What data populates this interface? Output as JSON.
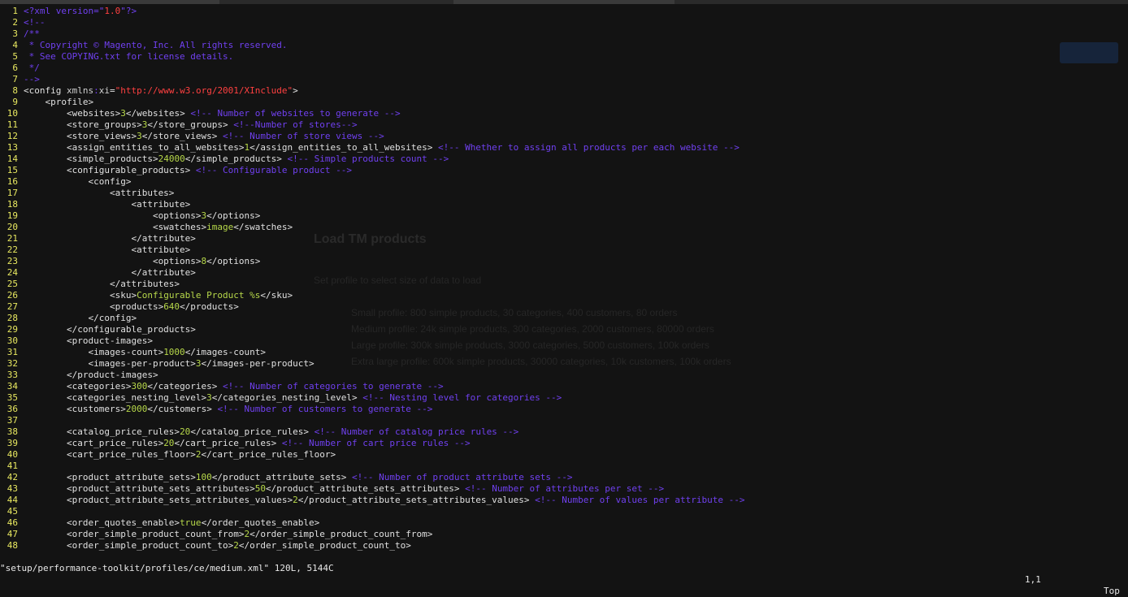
{
  "status_bar": {
    "file_info": "\"setup/performance-toolkit/profiles/ce/medium.xml\" 120L, 5144C",
    "cursor": "1,1",
    "scroll": "Top"
  },
  "background_ghost": {
    "heading": "Load TM products",
    "subtitle": "Set profile to select size of data to load",
    "items": [
      "Small profile: 800 simple products, 30 categories, 400 customers, 80 orders",
      "Medium profile: 24k simple products, 300 categories, 2000 customers, 80000 orders",
      "Large profile: 300k simple products, 3000 categories, 5000 customers, 100k orders",
      "Extra large profile: 600k simple products, 30000 categories, 10k customers, 100k orders"
    ]
  },
  "lines": [
    {
      "n": "1",
      "t": [
        [
          "cmt",
          "<?xml version=\""
        ],
        [
          "str",
          "1.0"
        ],
        [
          "cmt",
          "\"?>"
        ]
      ]
    },
    {
      "n": "2",
      "t": [
        [
          "cmt",
          "<!--"
        ]
      ]
    },
    {
      "n": "3",
      "t": [
        [
          "cmt",
          "/**"
        ]
      ]
    },
    {
      "n": "4",
      "t": [
        [
          "cmt",
          " * Copyright © Magento, Inc. All rights reserved."
        ]
      ]
    },
    {
      "n": "5",
      "t": [
        [
          "cmt",
          " * See COPYING.txt for license details."
        ]
      ]
    },
    {
      "n": "6",
      "t": [
        [
          "cmt",
          " */"
        ]
      ]
    },
    {
      "n": "7",
      "t": [
        [
          "cmt",
          "-->"
        ]
      ]
    },
    {
      "n": "8",
      "t": [
        [
          "tag",
          "<config "
        ],
        [
          "attr",
          "xmlns"
        ],
        [
          "cmt",
          ":"
        ],
        [
          "attr",
          "xi"
        ],
        [
          "tag",
          "="
        ],
        [
          "str",
          "\"http://www.w3.org/2001/XInclude\""
        ],
        [
          "tag",
          ">"
        ]
      ]
    },
    {
      "n": "9",
      "t": [
        [
          "tag",
          "    <profile>"
        ]
      ]
    },
    {
      "n": "10",
      "t": [
        [
          "tag",
          "        <websites>"
        ],
        [
          "val",
          "3"
        ],
        [
          "tag",
          "</websites> "
        ],
        [
          "cmt",
          "<!-- Number of websites to generate -->"
        ]
      ]
    },
    {
      "n": "11",
      "t": [
        [
          "tag",
          "        <store_groups>"
        ],
        [
          "val",
          "3"
        ],
        [
          "tag",
          "</store_groups> "
        ],
        [
          "cmt",
          "<!--Number of stores-->"
        ]
      ]
    },
    {
      "n": "12",
      "t": [
        [
          "tag",
          "        <store_views>"
        ],
        [
          "val",
          "3"
        ],
        [
          "tag",
          "</store_views> "
        ],
        [
          "cmt",
          "<!-- Number of store views -->"
        ]
      ]
    },
    {
      "n": "13",
      "t": [
        [
          "tag",
          "        <assign_entities_to_all_websites>"
        ],
        [
          "val",
          "1"
        ],
        [
          "tag",
          "</assign_entities_to_all_websites> "
        ],
        [
          "cmt",
          "<!-- Whether to assign all products per each website -->"
        ]
      ]
    },
    {
      "n": "14",
      "t": [
        [
          "tag",
          "        <simple_products>"
        ],
        [
          "val",
          "24000"
        ],
        [
          "tag",
          "</simple_products> "
        ],
        [
          "cmt",
          "<!-- Simple products count -->"
        ]
      ]
    },
    {
      "n": "15",
      "t": [
        [
          "tag",
          "        <configurable_products> "
        ],
        [
          "cmt",
          "<!-- Configurable product -->"
        ]
      ]
    },
    {
      "n": "16",
      "t": [
        [
          "tag",
          "            <config>"
        ]
      ]
    },
    {
      "n": "17",
      "t": [
        [
          "tag",
          "                <attributes>"
        ]
      ]
    },
    {
      "n": "18",
      "t": [
        [
          "tag",
          "                    <attribute>"
        ]
      ]
    },
    {
      "n": "19",
      "t": [
        [
          "tag",
          "                        <options>"
        ],
        [
          "val",
          "3"
        ],
        [
          "tag",
          "</options>"
        ]
      ]
    },
    {
      "n": "20",
      "t": [
        [
          "tag",
          "                        <swatches>"
        ],
        [
          "val",
          "image"
        ],
        [
          "tag",
          "</swatches>"
        ]
      ]
    },
    {
      "n": "21",
      "t": [
        [
          "tag",
          "                    </attribute>"
        ]
      ]
    },
    {
      "n": "22",
      "t": [
        [
          "tag",
          "                    <attribute>"
        ]
      ]
    },
    {
      "n": "23",
      "t": [
        [
          "tag",
          "                        <options>"
        ],
        [
          "val",
          "8"
        ],
        [
          "tag",
          "</options>"
        ]
      ]
    },
    {
      "n": "24",
      "t": [
        [
          "tag",
          "                    </attribute>"
        ]
      ]
    },
    {
      "n": "25",
      "t": [
        [
          "tag",
          "                </attributes>"
        ]
      ]
    },
    {
      "n": "26",
      "t": [
        [
          "tag",
          "                <sku>"
        ],
        [
          "val",
          "Configurable Product %s"
        ],
        [
          "tag",
          "</sku>"
        ]
      ]
    },
    {
      "n": "27",
      "t": [
        [
          "tag",
          "                <products>"
        ],
        [
          "val",
          "640"
        ],
        [
          "tag",
          "</products>"
        ]
      ]
    },
    {
      "n": "28",
      "t": [
        [
          "tag",
          "            </config>"
        ]
      ]
    },
    {
      "n": "29",
      "t": [
        [
          "tag",
          "        </configurable_products>"
        ]
      ]
    },
    {
      "n": "30",
      "t": [
        [
          "tag",
          "        <product-images>"
        ]
      ]
    },
    {
      "n": "31",
      "t": [
        [
          "tag",
          "            <images-count>"
        ],
        [
          "val",
          "1000"
        ],
        [
          "tag",
          "</images-count>"
        ]
      ]
    },
    {
      "n": "32",
      "t": [
        [
          "tag",
          "            <images-per-product>"
        ],
        [
          "val",
          "3"
        ],
        [
          "tag",
          "</images-per-product>"
        ]
      ]
    },
    {
      "n": "33",
      "t": [
        [
          "tag",
          "        </product-images>"
        ]
      ]
    },
    {
      "n": "34",
      "t": [
        [
          "tag",
          "        <categories>"
        ],
        [
          "val",
          "300"
        ],
        [
          "tag",
          "</categories> "
        ],
        [
          "cmt",
          "<!-- Number of categories to generate -->"
        ]
      ]
    },
    {
      "n": "35",
      "t": [
        [
          "tag",
          "        <categories_nesting_level>"
        ],
        [
          "val",
          "3"
        ],
        [
          "tag",
          "</categories_nesting_level> "
        ],
        [
          "cmt",
          "<!-- Nesting level for categories -->"
        ]
      ]
    },
    {
      "n": "36",
      "t": [
        [
          "tag",
          "        <customers>"
        ],
        [
          "val",
          "2000"
        ],
        [
          "tag",
          "</customers> "
        ],
        [
          "cmt",
          "<!-- Number of customers to generate -->"
        ]
      ]
    },
    {
      "n": "37",
      "t": []
    },
    {
      "n": "38",
      "t": [
        [
          "tag",
          "        <catalog_price_rules>"
        ],
        [
          "val",
          "20"
        ],
        [
          "tag",
          "</catalog_price_rules> "
        ],
        [
          "cmt",
          "<!-- Number of catalog price rules -->"
        ]
      ]
    },
    {
      "n": "39",
      "t": [
        [
          "tag",
          "        <cart_price_rules>"
        ],
        [
          "val",
          "20"
        ],
        [
          "tag",
          "</cart_price_rules> "
        ],
        [
          "cmt",
          "<!-- Number of cart price rules -->"
        ]
      ]
    },
    {
      "n": "40",
      "t": [
        [
          "tag",
          "        <cart_price_rules_floor>"
        ],
        [
          "val",
          "2"
        ],
        [
          "tag",
          "</cart_price_rules_floor>"
        ]
      ]
    },
    {
      "n": "41",
      "t": []
    },
    {
      "n": "42",
      "t": [
        [
          "tag",
          "        <product_attribute_sets>"
        ],
        [
          "val",
          "100"
        ],
        [
          "tag",
          "</product_attribute_sets> "
        ],
        [
          "cmt",
          "<!-- Number of product attribute sets -->"
        ]
      ]
    },
    {
      "n": "43",
      "t": [
        [
          "tag",
          "        <product_attribute_sets_attributes>"
        ],
        [
          "val",
          "50"
        ],
        [
          "tag",
          "</product_attribute_sets_attributes> "
        ],
        [
          "cmt",
          "<!-- Number of attributes per set -->"
        ]
      ]
    },
    {
      "n": "44",
      "t": [
        [
          "tag",
          "        <product_attribute_sets_attributes_values>"
        ],
        [
          "val",
          "2"
        ],
        [
          "tag",
          "</product_attribute_sets_attributes_values> "
        ],
        [
          "cmt",
          "<!-- Number of values per attribute -->"
        ]
      ]
    },
    {
      "n": "45",
      "t": []
    },
    {
      "n": "46",
      "t": [
        [
          "tag",
          "        <order_quotes_enable>"
        ],
        [
          "val",
          "true"
        ],
        [
          "tag",
          "</order_quotes_enable>"
        ]
      ]
    },
    {
      "n": "47",
      "t": [
        [
          "tag",
          "        <order_simple_product_count_from>"
        ],
        [
          "val",
          "2"
        ],
        [
          "tag",
          "</order_simple_product_count_from>"
        ]
      ]
    },
    {
      "n": "48",
      "t": [
        [
          "tag",
          "        <order_simple_product_count_to>"
        ],
        [
          "val",
          "2"
        ],
        [
          "tag",
          "</order_simple_product_count_to>"
        ]
      ]
    }
  ]
}
